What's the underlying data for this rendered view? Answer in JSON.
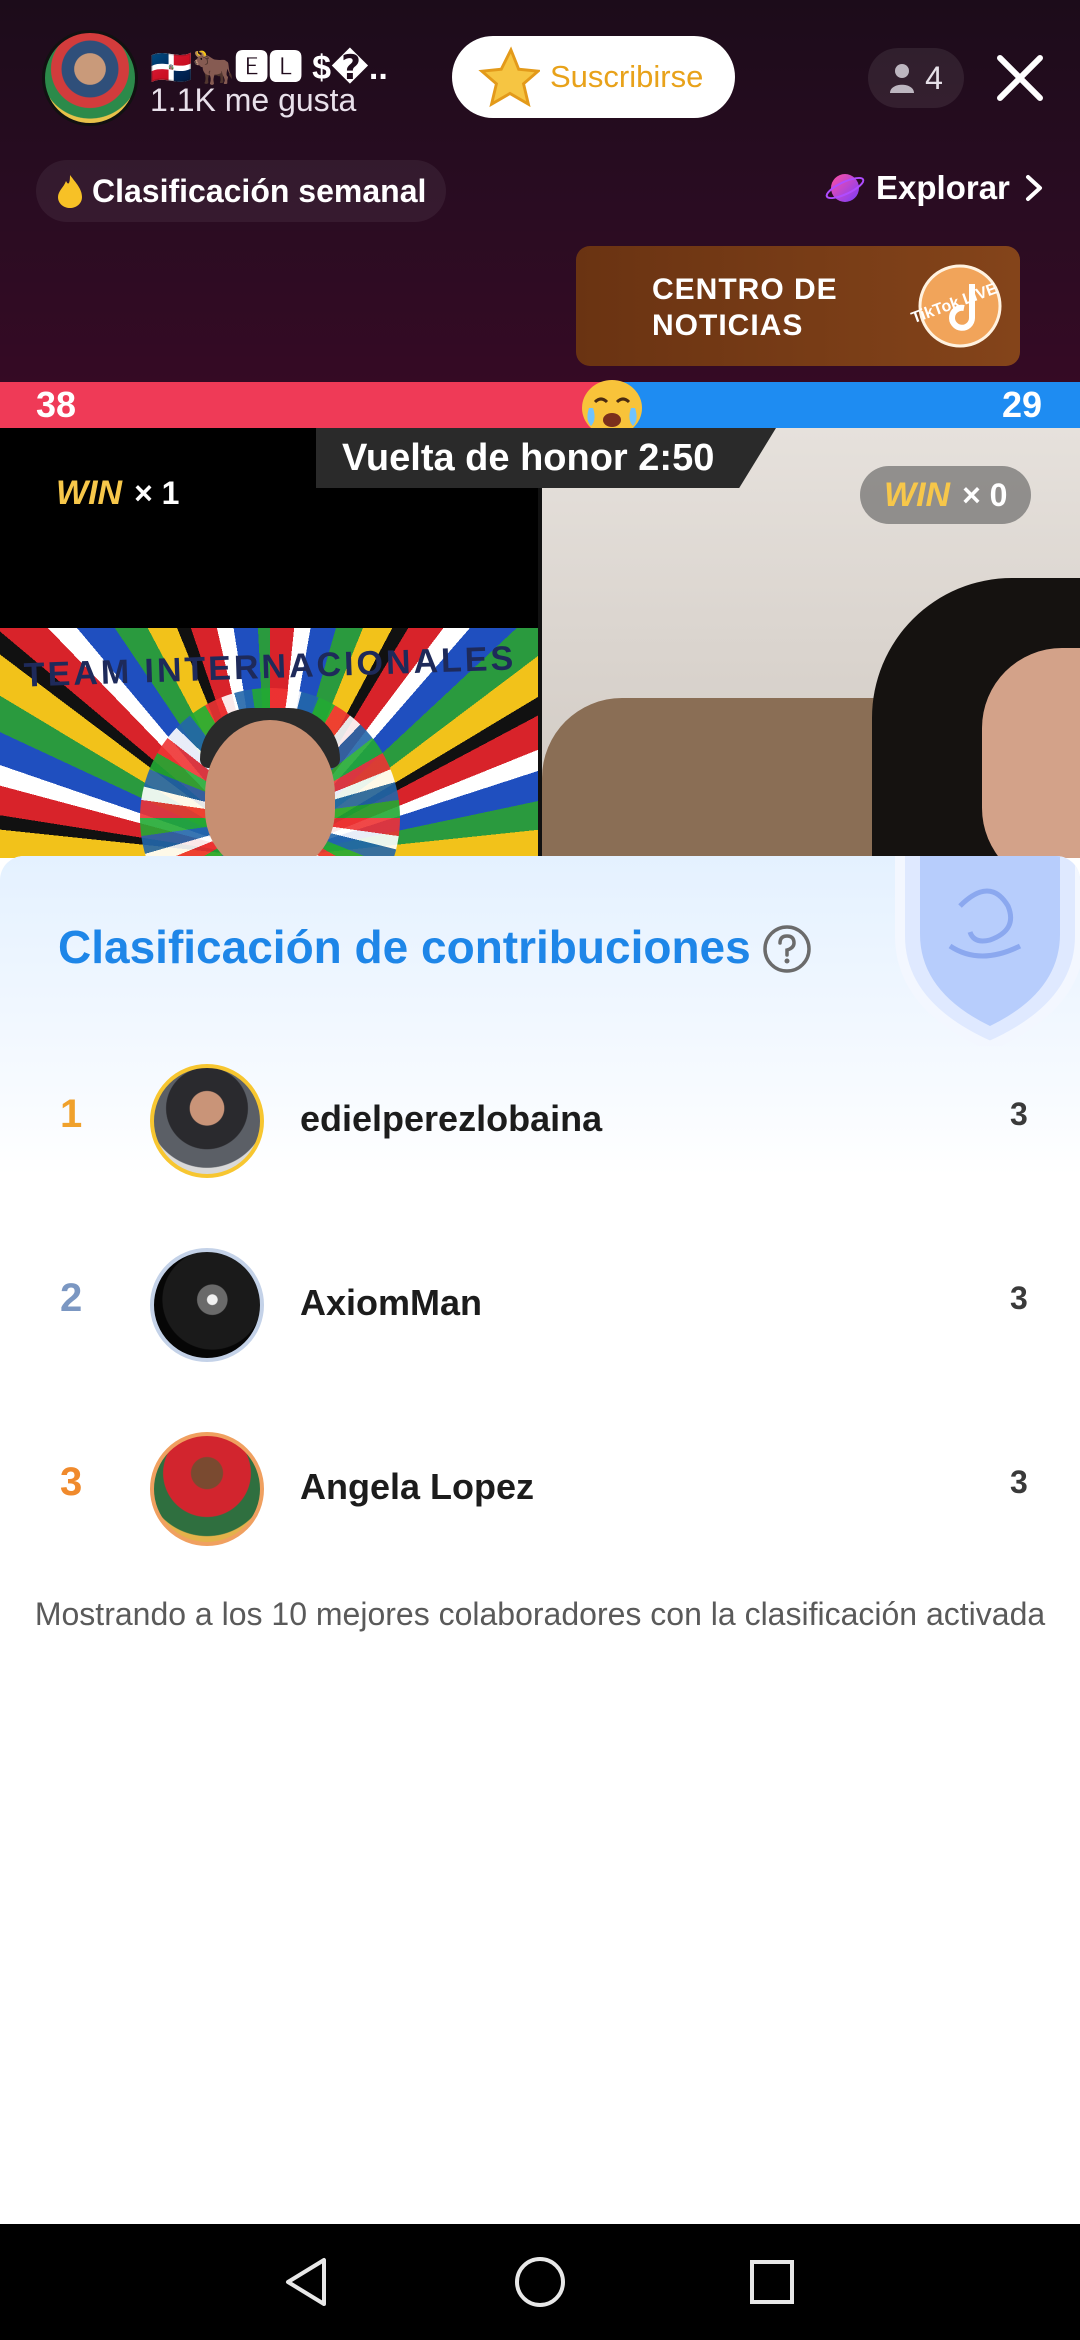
{
  "header": {
    "host_name": "🇩🇴🐂🅴🅻 $�..",
    "likes": "1.1K me gusta",
    "subscribe_label": "Suscribirse",
    "viewer_count": "4",
    "weekly_label": "Clasificación semanal",
    "explore_label": "Explorar",
    "news_card_line1": "CENTRO DE",
    "news_card_line2": "NOTICIAS",
    "news_card_badge": "TikTok LIVE"
  },
  "battle": {
    "score_left": "38",
    "score_right": "29",
    "timer": "Vuelta de honor 2:50",
    "left_win_word": "WIN",
    "left_win_count": "× 1",
    "right_win_word": "WIN",
    "right_win_count": "× 0",
    "left_banner_text": "TEAM INTERNACIONALES",
    "score_progress_left_fraction": 0.567
  },
  "sheet": {
    "title": "Clasificación de contribuciones",
    "rows": [
      {
        "rank": "1",
        "name": "edielperezlobaina",
        "score": "3"
      },
      {
        "rank": "2",
        "name": "AxiomMan",
        "score": "3"
      },
      {
        "rank": "3",
        "name": "Angela Lopez",
        "score": "3"
      }
    ],
    "footer_note": "Mostrando a los 10 mejores colaboradores con la clasificación activada"
  },
  "colors": {
    "accent_blue": "#1e86e8",
    "battle_red": "#ef3a57",
    "battle_blue": "#1e8cf2",
    "gold": "#f0a12c",
    "subscribe_text": "#e8a21a"
  },
  "icons": {
    "close": "close-icon",
    "viewers": "person-icon",
    "help": "help-icon",
    "explore": "planet-icon",
    "weekly": "flame-icon",
    "nav_back": "back-triangle-icon",
    "nav_home": "home-circle-icon",
    "nav_recent": "recents-square-icon"
  }
}
